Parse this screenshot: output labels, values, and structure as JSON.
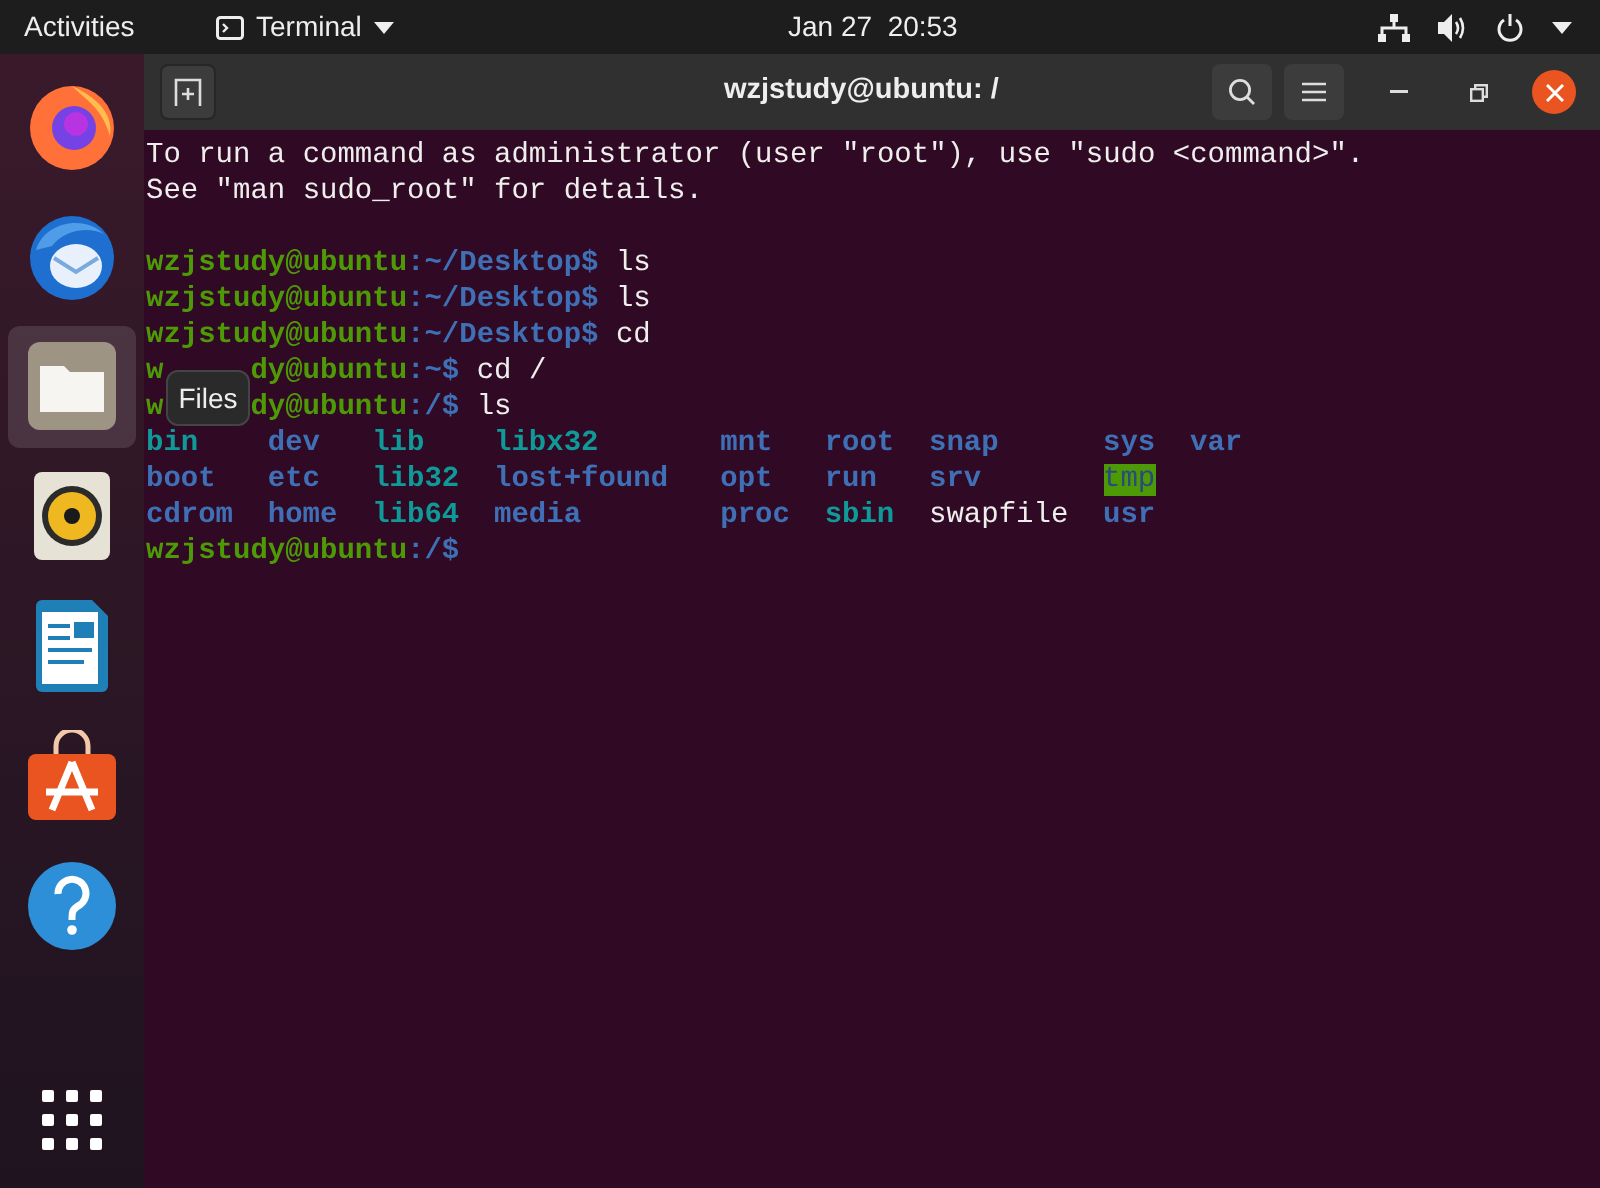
{
  "top_bar": {
    "activities": "Activities",
    "app_menu": "Terminal",
    "clock": "Jan 27  20:53"
  },
  "dock": {
    "items": [
      {
        "kind": "firefox",
        "selected": false
      },
      {
        "kind": "mail",
        "selected": false
      },
      {
        "kind": "files",
        "selected": true
      },
      {
        "kind": "speaker",
        "selected": false
      },
      {
        "kind": "writer",
        "selected": false
      },
      {
        "kind": "store",
        "selected": false
      },
      {
        "kind": "help",
        "selected": false
      },
      {
        "kind": "apps",
        "selected": false
      }
    ],
    "tooltip": "Files"
  },
  "window": {
    "title": "wzjstudy@ubuntu: /"
  },
  "terminal": {
    "lines": [
      {
        "kind": "text",
        "text": "To run a command as administrator (user \"root\"), use \"sudo <command>\"."
      },
      {
        "kind": "text",
        "text": "See \"man sudo_root\" for details."
      },
      {
        "kind": "blank"
      },
      {
        "kind": "prompt",
        "user_parts": [
          "wzjstudy@ubuntu"
        ],
        "path": ":~/Desktop$",
        "command": "ls"
      },
      {
        "kind": "prompt",
        "user_parts": [
          "wzjstudy@ubuntu"
        ],
        "path": ":~/Desktop$",
        "command": "ls"
      },
      {
        "kind": "prompt",
        "user_parts": [
          "wzjstudy@ubuntu"
        ],
        "path": ":~/Desktop$",
        "command": "cd"
      },
      {
        "kind": "prompt",
        "user_parts": [
          "w",
          "dy@ubuntu"
        ],
        "path": ":~$",
        "command": "cd /"
      },
      {
        "kind": "prompt",
        "user_parts": [
          "w",
          "dy@ubuntu"
        ],
        "path": ":/$",
        "command": "ls"
      },
      {
        "kind": "ls",
        "entries": [
          {
            "name": "bin",
            "kind": "link"
          },
          {
            "name": "dev",
            "kind": "dir"
          },
          {
            "name": "lib",
            "kind": "link"
          },
          {
            "name": "libx32",
            "kind": "link"
          },
          {
            "name": "mnt",
            "kind": "dir"
          },
          {
            "name": "root",
            "kind": "dir"
          },
          {
            "name": "snap",
            "kind": "dir"
          },
          {
            "name": "sys",
            "kind": "dir"
          },
          {
            "name": "var",
            "kind": "dir"
          }
        ]
      },
      {
        "kind": "ls",
        "entries": [
          {
            "name": "boot",
            "kind": "dir"
          },
          {
            "name": "etc",
            "kind": "dir"
          },
          {
            "name": "lib32",
            "kind": "link"
          },
          {
            "name": "lost+found",
            "kind": "dir"
          },
          {
            "name": "opt",
            "kind": "dir"
          },
          {
            "name": "run",
            "kind": "dir"
          },
          {
            "name": "srv",
            "kind": "dir"
          },
          {
            "name": "tmp",
            "kind": "sticky"
          }
        ]
      },
      {
        "kind": "ls",
        "entries": [
          {
            "name": "cdrom",
            "kind": "dir"
          },
          {
            "name": "home",
            "kind": "dir"
          },
          {
            "name": "lib64",
            "kind": "link"
          },
          {
            "name": "media",
            "kind": "dir"
          },
          {
            "name": "proc",
            "kind": "dir"
          },
          {
            "name": "sbin",
            "kind": "link"
          },
          {
            "name": "swapfile",
            "kind": "file"
          },
          {
            "name": "usr",
            "kind": "dir"
          }
        ]
      },
      {
        "kind": "prompt",
        "user_parts": [
          "wzjstudy@ubuntu"
        ],
        "path": ":/$"
      }
    ]
  }
}
